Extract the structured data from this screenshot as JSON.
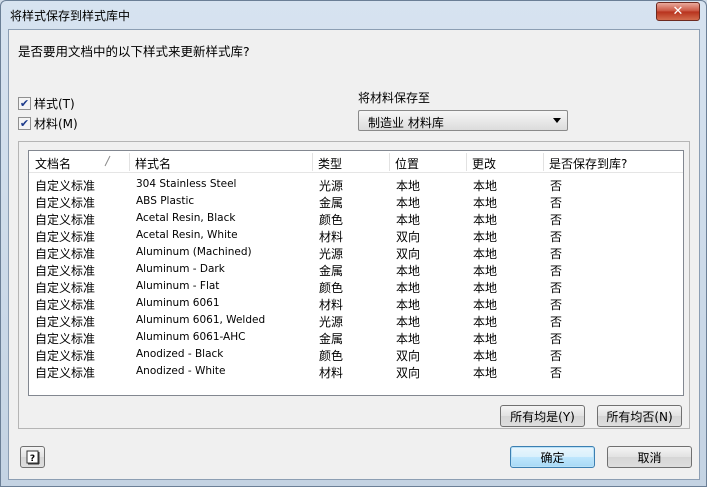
{
  "window": {
    "title": "将样式保存到样式库中",
    "close_glyph": "✕"
  },
  "question": "是否要用文档中的以下样式来更新样式库?",
  "options": {
    "styles": {
      "label": "样式(T)",
      "checked": true
    },
    "materials": {
      "label": "材料(M)",
      "checked": true
    }
  },
  "save_to": {
    "label": "将材料保存至",
    "selected": "制造业 材料库"
  },
  "table": {
    "columns": [
      "文档名",
      "样式名",
      "类型",
      "位置",
      "更改",
      "是否保存到库?"
    ],
    "rows": [
      [
        "自定义标准",
        "304 Stainless Steel",
        "光源",
        "本地",
        "本地",
        "否"
      ],
      [
        "自定义标准",
        "ABS Plastic",
        "金属",
        "本地",
        "本地",
        "否"
      ],
      [
        "自定义标准",
        "Acetal Resin, Black",
        "颜色",
        "本地",
        "本地",
        "否"
      ],
      [
        "自定义标准",
        "Acetal Resin, White",
        "材料",
        "双向",
        "本地",
        "否"
      ],
      [
        "自定义标准",
        "Aluminum (Machined)",
        "光源",
        "双向",
        "本地",
        "否"
      ],
      [
        "自定义标准",
        "Aluminum - Dark",
        "金属",
        "本地",
        "本地",
        "否"
      ],
      [
        "自定义标准",
        "Aluminum - Flat",
        "颜色",
        "本地",
        "本地",
        "否"
      ],
      [
        "自定义标准",
        "Aluminum 6061",
        "材料",
        "本地",
        "本地",
        "否"
      ],
      [
        "自定义标准",
        "Aluminum 6061, Welded",
        "光源",
        "本地",
        "本地",
        "否"
      ],
      [
        "自定义标准",
        "Aluminum 6061-AHC",
        "金属",
        "本地",
        "本地",
        "否"
      ],
      [
        "自定义标准",
        "Anodized - Black",
        "颜色",
        "双向",
        "本地",
        "否"
      ],
      [
        "自定义标准",
        "Anodized - White",
        "材料",
        "双向",
        "本地",
        "否"
      ]
    ]
  },
  "buttons": {
    "yes_to_all": "所有均是(Y)",
    "no_to_all": "所有均否(N)",
    "ok": "确定",
    "cancel": "取消",
    "help_glyph": "?"
  },
  "icons": {
    "help": "help-icon",
    "sort": "sort-indicator-icon",
    "close": "close-icon"
  }
}
